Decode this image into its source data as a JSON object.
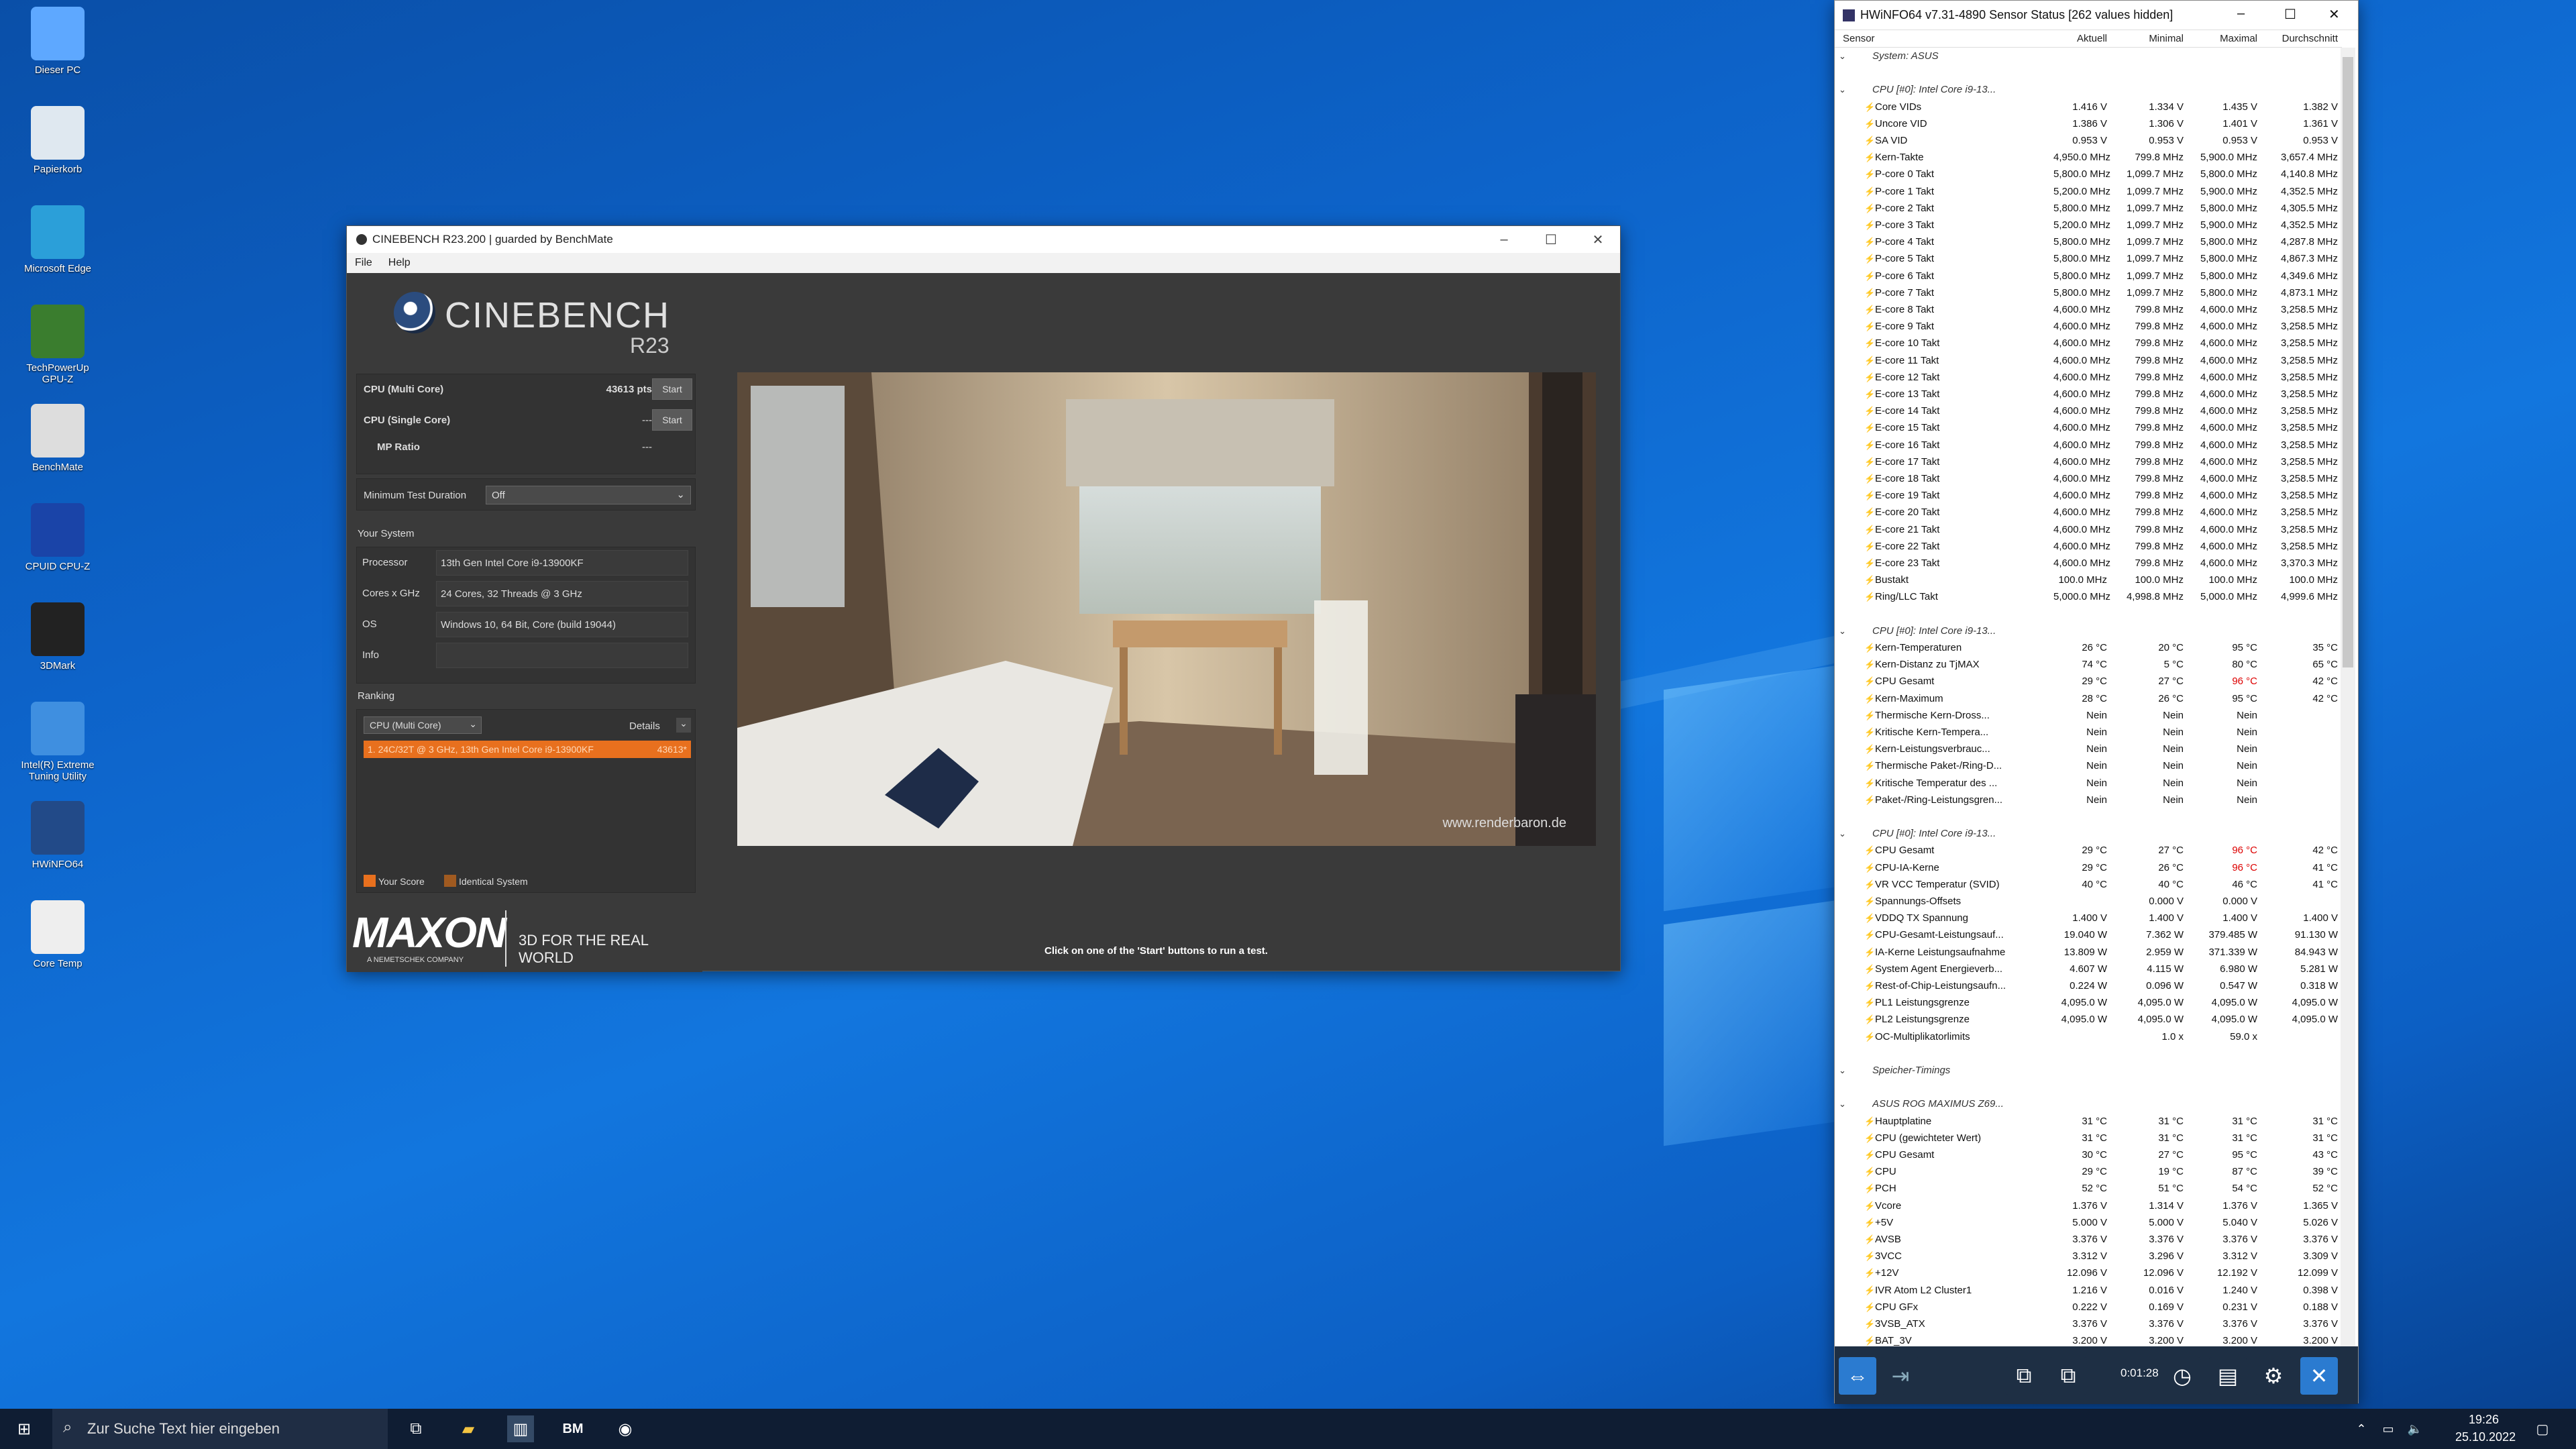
{
  "desktop_icons": [
    {
      "label": "Dieser PC",
      "icon": "computer-icon"
    },
    {
      "label": "Papierkorb",
      "icon": "recycle-bin-icon"
    },
    {
      "label": "Microsoft Edge",
      "icon": "edge-icon"
    },
    {
      "label": "TechPowerUp GPU-Z",
      "icon": "gpuz-icon"
    },
    {
      "label": "BenchMate",
      "icon": "benchmate-icon"
    },
    {
      "label": "CPUID CPU-Z",
      "icon": "cpuz-icon"
    },
    {
      "label": "3DMark",
      "icon": "3dmark-icon"
    },
    {
      "label": "Intel(R) Extreme Tuning Utility",
      "icon": "xtu-icon"
    },
    {
      "label": "HWiNFO64",
      "icon": "hwinfo-icon"
    },
    {
      "label": "Core Temp",
      "icon": "coretemp-icon"
    }
  ],
  "cinebench": {
    "title": "CINEBENCH R23.200 | guarded by BenchMate",
    "menu": [
      "File",
      "Help"
    ],
    "logo_name": "CINEBENCH",
    "logo_version": "R23",
    "tests": [
      {
        "label": "CPU (Multi Core)",
        "score": "43613 pts",
        "button": "Start"
      },
      {
        "label": "CPU (Single Core)",
        "score": "---",
        "button": "Start"
      },
      {
        "label": "MP Ratio",
        "score": "---"
      }
    ],
    "min_duration_label": "Minimum Test Duration",
    "min_duration_value": "Off",
    "your_system": "Your System",
    "system": [
      {
        "label": "Processor",
        "value": "13th Gen Intel Core i9-13900KF"
      },
      {
        "label": "Cores x GHz",
        "value": "24 Cores, 32 Threads @ 3 GHz"
      },
      {
        "label": "OS",
        "value": "Windows 10, 64 Bit, Core (build 19044)"
      },
      {
        "label": "Info",
        "value": ""
      }
    ],
    "ranking": "Ranking",
    "ranking_select": "CPU (Multi Core)",
    "details": "Details",
    "rank_entry": "1. 24C/32T @ 3 GHz, 13th Gen Intel Core i9-13900KF",
    "rank_score": "43613*",
    "legend_your": "Your Score",
    "legend_identical": "Identical System",
    "maxon": "MAXON",
    "maxon_sub": "A NEMETSCHEK COMPANY",
    "slogan": "3D FOR THE REAL WORLD",
    "status": "Click on one of the 'Start' buttons to run a test.",
    "watermark": "www.renderbaron.de",
    "colors": {
      "accent": "#e8701e",
      "bg": "#3a3a3a"
    }
  },
  "hwinfo": {
    "title": "HWiNFO64 v7.31-4890 Sensor Status [262 values hidden]",
    "columns": [
      "Sensor",
      "Aktuell",
      "Minimal",
      "Maximal",
      "Durchschnitt"
    ],
    "rows": [
      [
        "g",
        "System: ASUS",
        "",
        "",
        "",
        ""
      ],
      [
        "s",
        "",
        "",
        "",
        "",
        ""
      ],
      [
        "g",
        "CPU [#0]: Intel Core i9-13...",
        "",
        "",
        "",
        ""
      ],
      [
        "r",
        "Core VIDs",
        "1.416 V",
        "1.334 V",
        "1.435 V",
        "1.382 V"
      ],
      [
        "r",
        "Uncore VID",
        "1.386 V",
        "1.306 V",
        "1.401 V",
        "1.361 V"
      ],
      [
        "r",
        "SA VID",
        "0.953 V",
        "0.953 V",
        "0.953 V",
        "0.953 V"
      ],
      [
        "r",
        "Kern-Takte",
        "4,950.0 MHz",
        "799.8 MHz",
        "5,900.0 MHz",
        "3,657.4 MHz"
      ],
      [
        "r",
        "P-core 0 Takt",
        "5,800.0 MHz",
        "1,099.7 MHz",
        "5,800.0 MHz",
        "4,140.8 MHz"
      ],
      [
        "r",
        "P-core 1 Takt",
        "5,200.0 MHz",
        "1,099.7 MHz",
        "5,900.0 MHz",
        "4,352.5 MHz"
      ],
      [
        "r",
        "P-core 2 Takt",
        "5,800.0 MHz",
        "1,099.7 MHz",
        "5,800.0 MHz",
        "4,305.5 MHz"
      ],
      [
        "r",
        "P-core 3 Takt",
        "5,200.0 MHz",
        "1,099.7 MHz",
        "5,900.0 MHz",
        "4,352.5 MHz"
      ],
      [
        "r",
        "P-core 4 Takt",
        "5,800.0 MHz",
        "1,099.7 MHz",
        "5,800.0 MHz",
        "4,287.8 MHz"
      ],
      [
        "r",
        "P-core 5 Takt",
        "5,800.0 MHz",
        "1,099.7 MHz",
        "5,800.0 MHz",
        "4,867.3 MHz"
      ],
      [
        "r",
        "P-core 6 Takt",
        "5,800.0 MHz",
        "1,099.7 MHz",
        "5,800.0 MHz",
        "4,349.6 MHz"
      ],
      [
        "r",
        "P-core 7 Takt",
        "5,800.0 MHz",
        "1,099.7 MHz",
        "5,800.0 MHz",
        "4,873.1 MHz"
      ],
      [
        "r",
        "E-core 8 Takt",
        "4,600.0 MHz",
        "799.8 MHz",
        "4,600.0 MHz",
        "3,258.5 MHz"
      ],
      [
        "r",
        "E-core 9 Takt",
        "4,600.0 MHz",
        "799.8 MHz",
        "4,600.0 MHz",
        "3,258.5 MHz"
      ],
      [
        "r",
        "E-core 10 Takt",
        "4,600.0 MHz",
        "799.8 MHz",
        "4,600.0 MHz",
        "3,258.5 MHz"
      ],
      [
        "r",
        "E-core 11 Takt",
        "4,600.0 MHz",
        "799.8 MHz",
        "4,600.0 MHz",
        "3,258.5 MHz"
      ],
      [
        "r",
        "E-core 12 Takt",
        "4,600.0 MHz",
        "799.8 MHz",
        "4,600.0 MHz",
        "3,258.5 MHz"
      ],
      [
        "r",
        "E-core 13 Takt",
        "4,600.0 MHz",
        "799.8 MHz",
        "4,600.0 MHz",
        "3,258.5 MHz"
      ],
      [
        "r",
        "E-core 14 Takt",
        "4,600.0 MHz",
        "799.8 MHz",
        "4,600.0 MHz",
        "3,258.5 MHz"
      ],
      [
        "r",
        "E-core 15 Takt",
        "4,600.0 MHz",
        "799.8 MHz",
        "4,600.0 MHz",
        "3,258.5 MHz"
      ],
      [
        "r",
        "E-core 16 Takt",
        "4,600.0 MHz",
        "799.8 MHz",
        "4,600.0 MHz",
        "3,258.5 MHz"
      ],
      [
        "r",
        "E-core 17 Takt",
        "4,600.0 MHz",
        "799.8 MHz",
        "4,600.0 MHz",
        "3,258.5 MHz"
      ],
      [
        "r",
        "E-core 18 Takt",
        "4,600.0 MHz",
        "799.8 MHz",
        "4,600.0 MHz",
        "3,258.5 MHz"
      ],
      [
        "r",
        "E-core 19 Takt",
        "4,600.0 MHz",
        "799.8 MHz",
        "4,600.0 MHz",
        "3,258.5 MHz"
      ],
      [
        "r",
        "E-core 20 Takt",
        "4,600.0 MHz",
        "799.8 MHz",
        "4,600.0 MHz",
        "3,258.5 MHz"
      ],
      [
        "r",
        "E-core 21 Takt",
        "4,600.0 MHz",
        "799.8 MHz",
        "4,600.0 MHz",
        "3,258.5 MHz"
      ],
      [
        "r",
        "E-core 22 Takt",
        "4,600.0 MHz",
        "799.8 MHz",
        "4,600.0 MHz",
        "3,258.5 MHz"
      ],
      [
        "r",
        "E-core 23 Takt",
        "4,600.0 MHz",
        "799.8 MHz",
        "4,600.0 MHz",
        "3,370.3 MHz"
      ],
      [
        "r",
        "Bustakt",
        "100.0 MHz",
        "100.0 MHz",
        "100.0 MHz",
        "100.0 MHz"
      ],
      [
        "r",
        "Ring/LLC Takt",
        "5,000.0 MHz",
        "4,998.8 MHz",
        "5,000.0 MHz",
        "4,999.6 MHz"
      ],
      [
        "s",
        "",
        "",
        "",
        "",
        ""
      ],
      [
        "g",
        "CPU [#0]: Intel Core i9-13...",
        "",
        "",
        "",
        ""
      ],
      [
        "r",
        "Kern-Temperaturen",
        "26 °C",
        "20 °C",
        "95 °C",
        "35 °C"
      ],
      [
        "r",
        "Kern-Distanz zu TjMAX",
        "74 °C",
        "5 °C",
        "80 °C",
        "65 °C"
      ],
      [
        "r",
        "CPU Gesamt",
        "29 °C",
        "27 °C",
        "96 °C*",
        "42 °C"
      ],
      [
        "r",
        "Kern-Maximum",
        "28 °C",
        "26 °C",
        "95 °C",
        "42 °C"
      ],
      [
        "r",
        "Thermische Kern-Dross...",
        "Nein",
        "Nein",
        "Nein",
        ""
      ],
      [
        "r",
        "Kritische Kern-Tempera...",
        "Nein",
        "Nein",
        "Nein",
        ""
      ],
      [
        "r",
        "Kern-Leistungsverbrauc...",
        "Nein",
        "Nein",
        "Nein",
        ""
      ],
      [
        "r",
        "Thermische Paket-/Ring-D...",
        "Nein",
        "Nein",
        "Nein",
        ""
      ],
      [
        "r",
        "Kritische Temperatur des ...",
        "Nein",
        "Nein",
        "Nein",
        ""
      ],
      [
        "r",
        "Paket-/Ring-Leistungsgren...",
        "Nein",
        "Nein",
        "Nein",
        ""
      ],
      [
        "s",
        "",
        "",
        "",
        "",
        ""
      ],
      [
        "g",
        "CPU [#0]: Intel Core i9-13...",
        "",
        "",
        "",
        ""
      ],
      [
        "r",
        "CPU Gesamt",
        "29 °C",
        "27 °C",
        "96 °C*",
        "42 °C"
      ],
      [
        "r",
        "CPU-IA-Kerne",
        "29 °C",
        "26 °C",
        "96 °C*",
        "41 °C"
      ],
      [
        "r",
        "VR VCC Temperatur (SVID)",
        "40 °C",
        "40 °C",
        "46 °C",
        "41 °C"
      ],
      [
        "r",
        "Spannungs-Offsets",
        "",
        "0.000 V",
        "0.000 V",
        ""
      ],
      [
        "r",
        "VDDQ TX Spannung",
        "1.400 V",
        "1.400 V",
        "1.400 V",
        "1.400 V"
      ],
      [
        "r",
        "CPU-Gesamt-Leistungsauf...",
        "19.040 W",
        "7.362 W",
        "379.485 W",
        "91.130 W"
      ],
      [
        "r",
        "IA-Kerne Leistungsaufnahme",
        "13.809 W",
        "2.959 W",
        "371.339 W",
        "84.943 W"
      ],
      [
        "r",
        "System Agent Energieverb...",
        "4.607 W",
        "4.115 W",
        "6.980 W",
        "5.281 W"
      ],
      [
        "r",
        "Rest-of-Chip-Leistungsaufn...",
        "0.224 W",
        "0.096 W",
        "0.547 W",
        "0.318 W"
      ],
      [
        "r",
        "PL1 Leistungsgrenze",
        "4,095.0 W",
        "4,095.0 W",
        "4,095.0 W",
        "4,095.0 W"
      ],
      [
        "r",
        "PL2 Leistungsgrenze",
        "4,095.0 W",
        "4,095.0 W",
        "4,095.0 W",
        "4,095.0 W"
      ],
      [
        "r",
        "OC-Multiplikatorlimits",
        "",
        "1.0 x",
        "59.0 x",
        ""
      ],
      [
        "s",
        "",
        "",
        "",
        "",
        ""
      ],
      [
        "g",
        "Speicher-Timings",
        "",
        "",
        "",
        ""
      ],
      [
        "s",
        "",
        "",
        "",
        "",
        ""
      ],
      [
        "g",
        "ASUS ROG MAXIMUS Z69...",
        "",
        "",
        "",
        ""
      ],
      [
        "r",
        "Hauptplatine",
        "31 °C",
        "31 °C",
        "31 °C",
        "31 °C"
      ],
      [
        "r",
        "CPU (gewichteter Wert)",
        "31 °C",
        "31 °C",
        "31 °C",
        "31 °C"
      ],
      [
        "r",
        "CPU Gesamt",
        "30 °C",
        "27 °C",
        "95 °C",
        "43 °C"
      ],
      [
        "r",
        "CPU",
        "29 °C",
        "19 °C",
        "87 °C",
        "39 °C"
      ],
      [
        "r",
        "PCH",
        "52 °C",
        "51 °C",
        "54 °C",
        "52 °C"
      ],
      [
        "r",
        "Vcore",
        "1.376 V",
        "1.314 V",
        "1.376 V",
        "1.365 V"
      ],
      [
        "r",
        "+5V",
        "5.000 V",
        "5.000 V",
        "5.040 V",
        "5.026 V"
      ],
      [
        "r",
        "AVSB",
        "3.376 V",
        "3.376 V",
        "3.376 V",
        "3.376 V"
      ],
      [
        "r",
        "3VCC",
        "3.312 V",
        "3.296 V",
        "3.312 V",
        "3.309 V"
      ],
      [
        "r",
        "+12V",
        "12.096 V",
        "12.096 V",
        "12.192 V",
        "12.099 V"
      ],
      [
        "r",
        "IVR Atom L2 Cluster1",
        "1.216 V",
        "0.016 V",
        "1.240 V",
        "0.398 V"
      ],
      [
        "r",
        "CPU GFx",
        "0.222 V",
        "0.169 V",
        "0.231 V",
        "0.188 V"
      ],
      [
        "r",
        "3VSB_ATX",
        "3.376 V",
        "3.376 V",
        "3.376 V",
        "3.376 V"
      ],
      [
        "r",
        "BAT_3V",
        "3.200 V",
        "3.200 V",
        "3.200 V",
        "3.200 V"
      ]
    ],
    "timer": "0:01:28"
  },
  "taskbar": {
    "search_placeholder": "Zur Suche Text hier eingeben",
    "time": "19:26",
    "date": "25.10.2022"
  }
}
